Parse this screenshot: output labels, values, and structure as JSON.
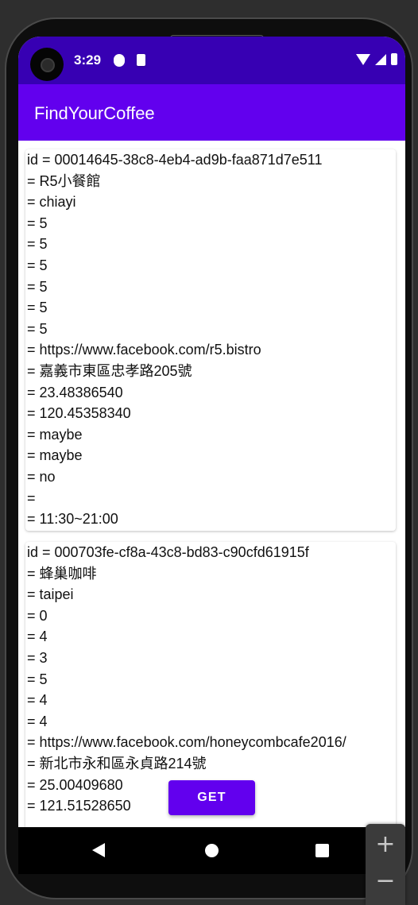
{
  "status_bar": {
    "time": "3:29",
    "icons": [
      "notification-icon",
      "sd-card-icon",
      "wifi-icon",
      "signal-icon",
      "battery-icon"
    ]
  },
  "app_bar": {
    "title": "FindYourCoffee",
    "color": "#6200ee",
    "status_color": "#3700b3"
  },
  "cards": [
    {
      "lines": [
        "id = 00014645-38c8-4eb4-ad9b-faa871d7e511",
        "= R5小餐館",
        "= chiayi",
        "= 5",
        "= 5",
        "= 5",
        "= 5",
        "= 5",
        "= 5",
        "= https://www.facebook.com/r5.bistro",
        "= 嘉義市東區忠孝路205號",
        "= 23.48386540",
        "= 120.45358340",
        "= maybe",
        "= maybe",
        "= no",
        "=",
        "= 11:30~21:00"
      ]
    },
    {
      "lines": [
        "id = 000703fe-cf8a-43c8-bd83-c90cfd61915f",
        "= 蜂巢咖啡",
        "= taipei",
        "= 0",
        "= 4",
        "= 3",
        "= 5",
        "= 4",
        "= 4",
        "= https://www.facebook.com/honeycombcafe2016/",
        "= 新北市永和區永貞路214號",
        "= 25.00409680",
        "= 121.51528650"
      ]
    }
  ],
  "get_button": {
    "label": "GET"
  },
  "nav_bar": {
    "icons": [
      "back-icon",
      "home-icon",
      "recents-icon"
    ]
  },
  "zoom_controls": {
    "plus": "+",
    "minus": "−"
  }
}
